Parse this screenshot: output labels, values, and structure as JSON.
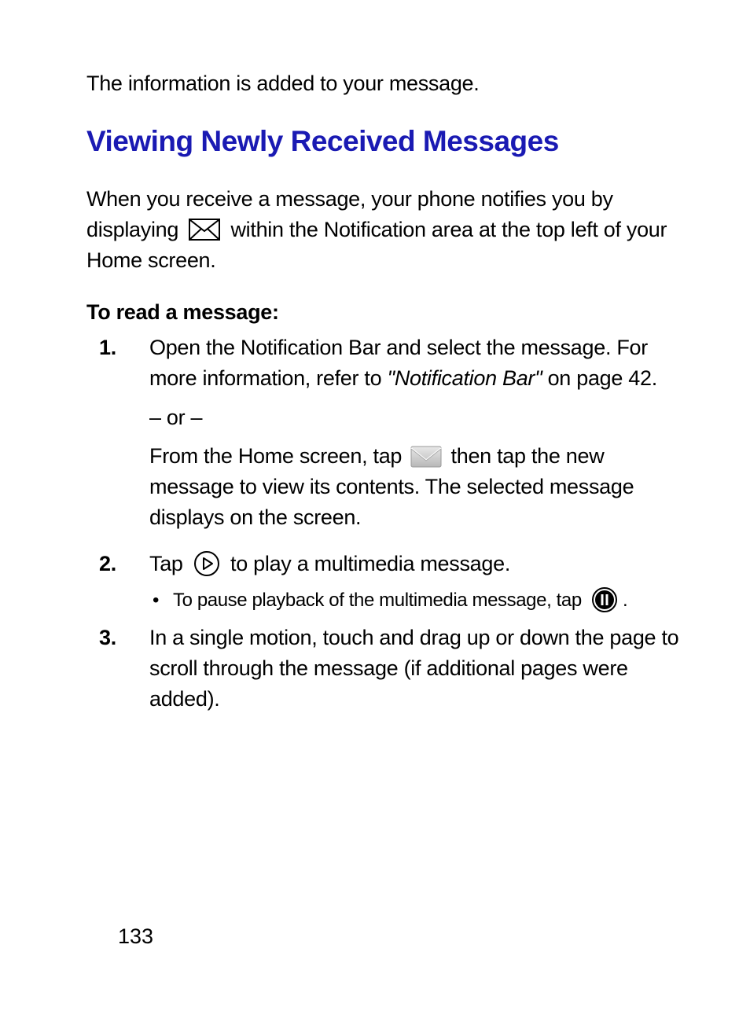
{
  "intro_line": "The information is added to your message.",
  "section_title": "Viewing Newly Received Messages",
  "desc_part1": "When you receive a message, your phone notifies you by displaying",
  "desc_part2": "within the Notification area at the top left of your Home screen.",
  "subhead": "To read a message:",
  "steps": {
    "s1": {
      "num": "1.",
      "p1a": "Open the Notification Bar and select the message. For more information, refer to ",
      "p1b_italic": "\"Notification Bar\"",
      "p1c": "  on page 42.",
      "or": "– or –",
      "p2a": "From the Home screen, tap ",
      "p2b": " then tap the new message to view its contents. The selected message displays on the screen."
    },
    "s2": {
      "num": "2.",
      "p1a": "Tap ",
      "p1b": " to play a multimedia message.",
      "bullet_a": "To pause playback of the multimedia message, tap ",
      "bullet_b": "."
    },
    "s3": {
      "num": "3.",
      "p1": "In a single motion, touch and drag up or down the page to scroll through the message (if additional pages were added)."
    }
  },
  "page_number": "133"
}
